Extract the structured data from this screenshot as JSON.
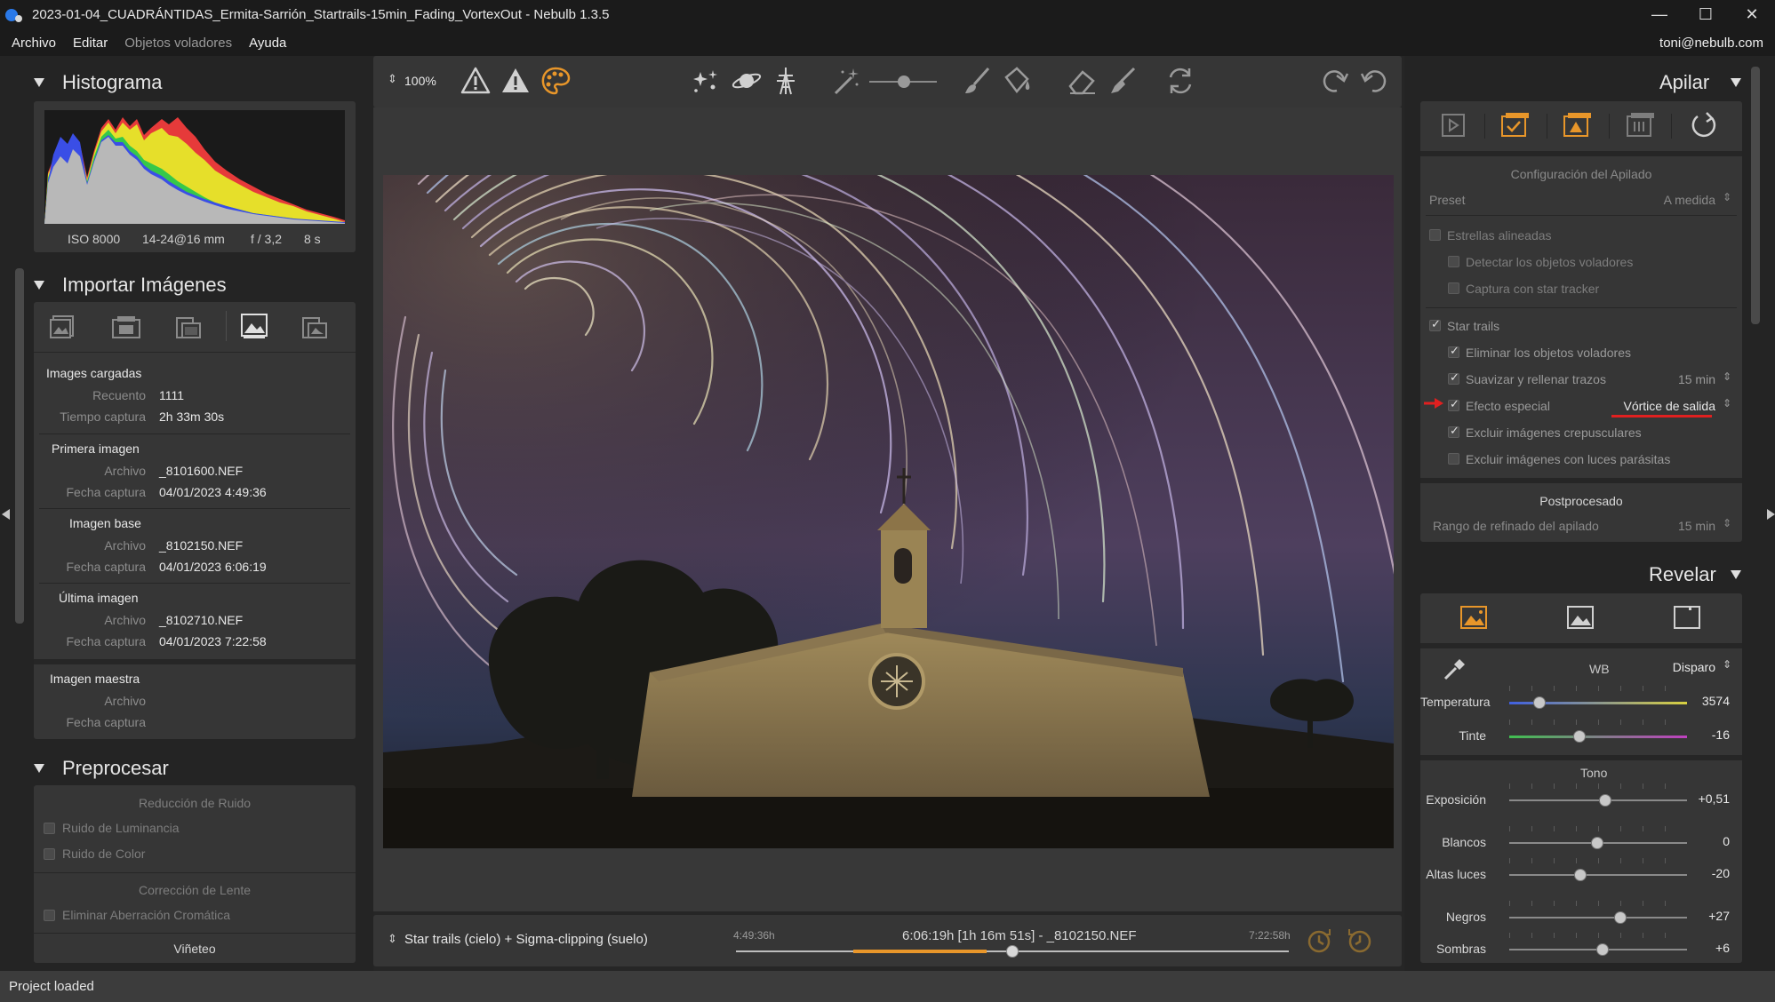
{
  "window": {
    "title": "2023-01-04_CUADRÁNTIDAS_Ermita-Sarrión_Startrails-15min_Fading_VortexOut - Nebulb 1.3.5",
    "controls": [
      "minimize",
      "maximize",
      "close"
    ]
  },
  "menu": {
    "items": [
      "Archivo",
      "Editar",
      "Objetos voladores",
      "Ayuda"
    ],
    "user": "toni@nebulb.com"
  },
  "histogram": {
    "title": "Histograma",
    "iso": "ISO 8000",
    "lens": "14-24@16 mm",
    "aperture": "f / 3,2",
    "exposure": "8 s"
  },
  "import": {
    "title": "Importar Imágenes",
    "loaded_header": "Images cargadas",
    "count_label": "Recuento",
    "count": "1111",
    "capture_time_label": "Tiempo captura",
    "capture_time": "2h 33m 30s",
    "first_header": "Primera imagen",
    "file_label": "Archivo",
    "date_label": "Fecha captura",
    "first_file": "_8101600.NEF",
    "first_date": "04/01/2023 4:49:36",
    "base_header": "Imagen base",
    "base_file": "_8102150.NEF",
    "base_date": "04/01/2023 6:06:19",
    "last_header": "Última imagen",
    "last_file": "_8102710.NEF",
    "last_date": "04/01/2023 7:22:58",
    "master_header": "Imagen maestra"
  },
  "preprocess": {
    "title": "Preprocesar",
    "noise_header": "Reducción de Ruido",
    "luminance": "Ruido de Luminancia",
    "color": "Ruido de Color",
    "lens_header": "Corrección de Lente",
    "chromatic": "Eliminar Aberración Cromática",
    "vignette": "Viñeteo"
  },
  "toolbar": {
    "zoom": "100%"
  },
  "timeline": {
    "mode": "Star trails (cielo) + Sigma-clipping (suelo)",
    "start": "4:49:36h",
    "current": "6:06:19h [1h 16m 51s] - _8102150.NEF",
    "end": "7:22:58h",
    "position": 0.5
  },
  "stack": {
    "title": "Apilar",
    "config_header": "Configuración del Apilado",
    "preset_label": "Preset",
    "preset_value": "A medida",
    "aligned": "Estrellas alineadas",
    "detect_flying": "Detectar los objetos voladores",
    "star_tracker": "Captura con star tracker",
    "star_trails": "Star trails",
    "remove_flying": "Eliminar los objetos voladores",
    "smooth": "Suavizar y rellenar trazos",
    "smooth_value": "15 min",
    "special": "Efecto especial",
    "special_value": "Vórtice de salida",
    "twilight": "Excluir imágenes crepusculares",
    "parasitic": "Excluir imágenes con luces parásitas",
    "post_header": "Postprocesado",
    "refine_label": "Rango de refinado del apilado",
    "refine_value": "15 min"
  },
  "develop": {
    "title": "Revelar",
    "wb_label": "WB",
    "wb_value": "Disparo",
    "temp_label": "Temperatura",
    "temp_value": "3574",
    "tint_label": "Tinte",
    "tint_value": "-16",
    "tone_header": "Tono",
    "exposure_label": "Exposición",
    "exposure_value": "+0,51",
    "whites_label": "Blancos",
    "whites_value": "0",
    "highlights_label": "Altas luces",
    "highlights_value": "-20",
    "blacks_label": "Negros",
    "blacks_value": "+27",
    "shadows_label": "Sombras",
    "shadows_value": "+6"
  },
  "status": {
    "text": "Project loaded"
  },
  "colors": {
    "accent_orange": "#e8962a",
    "annotation_red": "#e02020"
  }
}
